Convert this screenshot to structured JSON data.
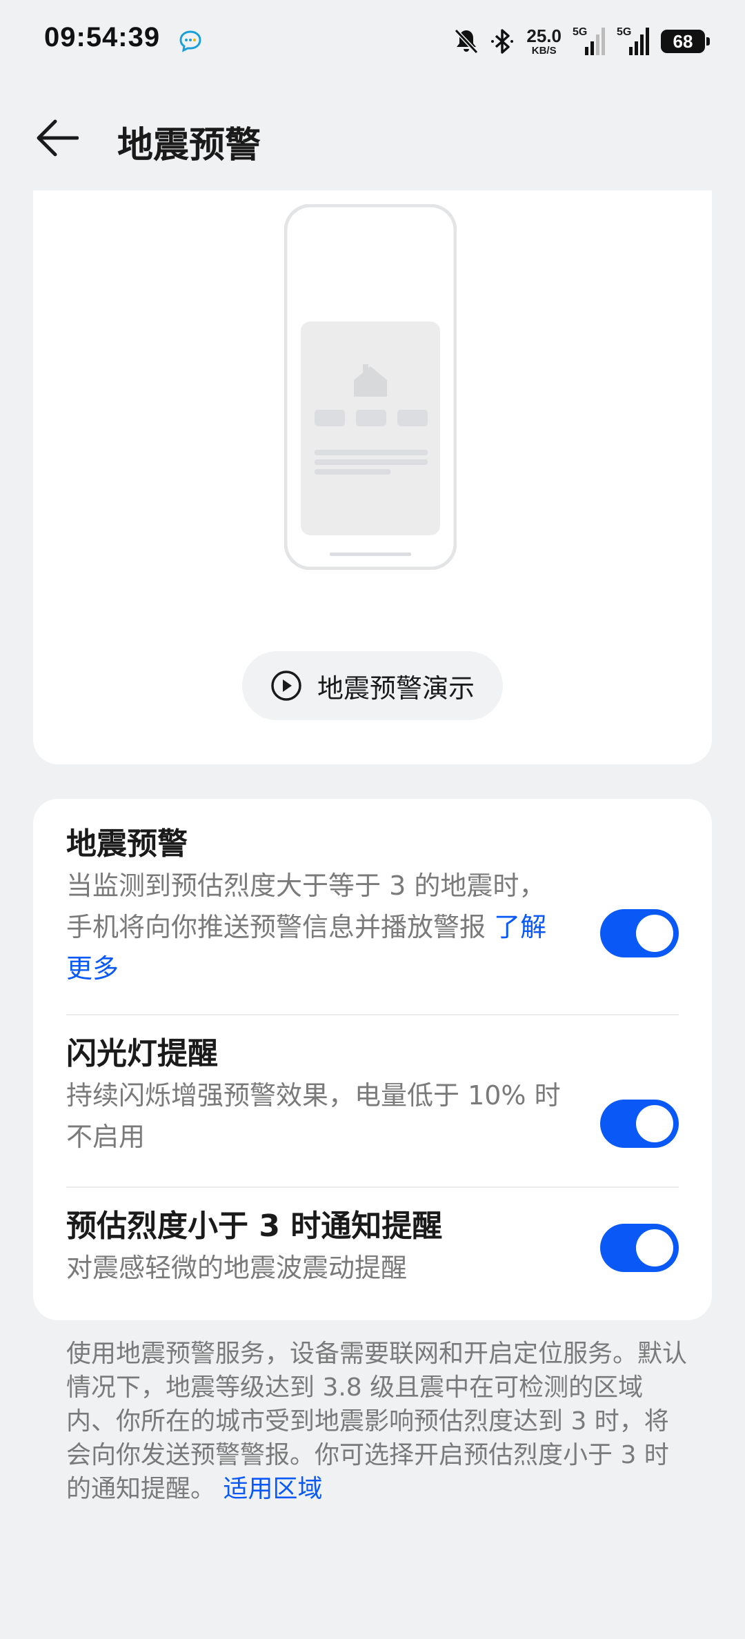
{
  "status_bar": {
    "time": "09:54:39",
    "net_speed_value": "25.0",
    "net_speed_unit": "KB/S",
    "sim1_label": "5G",
    "sim2_label": "5G",
    "battery": "68",
    "icons": [
      "message-bubble-icon",
      "bell-off-icon",
      "bluetooth-icon",
      "signal-icon",
      "battery-icon"
    ]
  },
  "header": {
    "title": "地震预警"
  },
  "demo": {
    "button_label": "地震预警演示"
  },
  "settings": [
    {
      "title": "地震预警",
      "desc": "当监测到预估烈度大于等于 3 的地震时，手机将向你推送预警信息并播放警报",
      "link": "了解更多",
      "enabled": true
    },
    {
      "title": "闪光灯提醒",
      "desc": "持续闪烁增强预警效果，电量低于 10% 时不启用",
      "enabled": true
    },
    {
      "title": "预估烈度小于 3 时通知提醒",
      "desc": "对震感轻微的地震波震动提醒",
      "enabled": true
    }
  ],
  "footnote": {
    "text": "使用地震预警服务，设备需要联网和开启定位服务。默认情况下，地震等级达到 3.8 级且震中在可检测的区域内、你所在的城市受到地震影响预估烈度达到 3 时，将会向你发送预警警报。你可选择开启预估烈度小于 3 时的通知提醒。",
    "link": "适用区域"
  },
  "colors": {
    "accent": "#0a59f7",
    "background": "#f0f1f3",
    "card": "#ffffff",
    "secondary_text": "#7a7a7a"
  }
}
